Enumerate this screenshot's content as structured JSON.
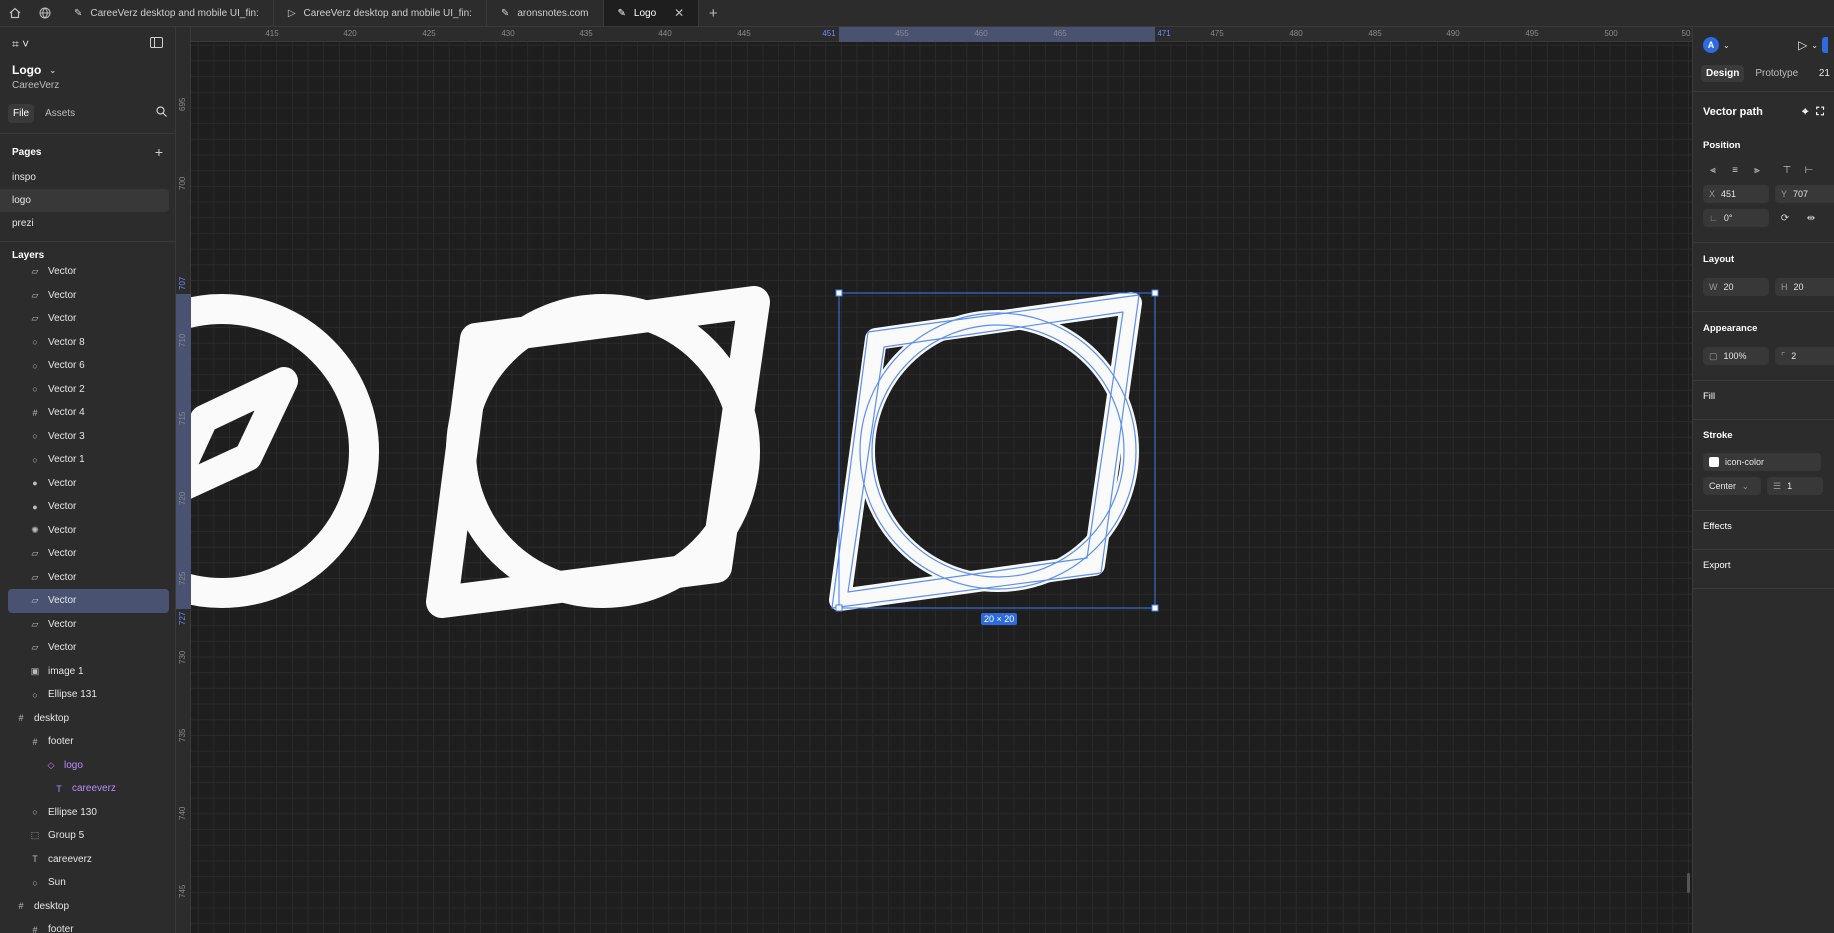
{
  "tabs": [
    {
      "label": "CareeVerz desktop and mobile UI_fin:",
      "active": false
    },
    {
      "label": "CareeVerz desktop and mobile UI_fin:",
      "active": false
    },
    {
      "label": "aronsnotes.com",
      "active": false
    },
    {
      "label": "Logo",
      "active": true
    }
  ],
  "file": {
    "title": "Logo",
    "subtitle": "CareeVerz"
  },
  "left": {
    "file_tab": "File",
    "assets_tab": "Assets",
    "pages_heading": "Pages",
    "pages": [
      "inspo",
      "logo",
      "prezi"
    ],
    "layers_heading": "Layers",
    "layers": [
      {
        "label": "Vector",
        "icon": "path"
      },
      {
        "label": "Vector",
        "icon": "path"
      },
      {
        "label": "Vector",
        "icon": "path"
      },
      {
        "label": "Vector 8",
        "icon": "ellipse"
      },
      {
        "label": "Vector 6",
        "icon": "ellipse"
      },
      {
        "label": "Vector 2",
        "icon": "ellipse"
      },
      {
        "label": "Vector 4",
        "icon": "frame"
      },
      {
        "label": "Vector 3",
        "icon": "ellipse"
      },
      {
        "label": "Vector 1",
        "icon": "ellipse"
      },
      {
        "label": "Vector",
        "icon": "filled"
      },
      {
        "label": "Vector",
        "icon": "filled"
      },
      {
        "label": "Vector",
        "icon": "sun"
      },
      {
        "label": "Vector",
        "icon": "path"
      },
      {
        "label": "Vector",
        "icon": "path"
      },
      {
        "label": "Vector",
        "icon": "path",
        "selected": true
      },
      {
        "label": "Vector",
        "icon": "path"
      },
      {
        "label": "Vector",
        "icon": "path"
      },
      {
        "label": "image 1",
        "icon": "image"
      },
      {
        "label": "Ellipse 131",
        "icon": "ellipse"
      },
      {
        "label": "desktop",
        "icon": "frame"
      },
      {
        "label": "footer",
        "icon": "frame"
      },
      {
        "label": "logo",
        "icon": "component"
      },
      {
        "label": "careeverz",
        "icon": "text"
      },
      {
        "label": "Ellipse 130",
        "icon": "ellipse"
      },
      {
        "label": "Group 5",
        "icon": "group"
      },
      {
        "label": "careeverz",
        "icon": "text"
      },
      {
        "label": "Sun",
        "icon": "ellipse"
      },
      {
        "label": "desktop",
        "icon": "frame"
      },
      {
        "label": "footer",
        "icon": "frame"
      }
    ]
  },
  "ruler": {
    "top": [
      "415",
      "420",
      "425",
      "430",
      "435",
      "440",
      "445",
      "451",
      "455",
      "460",
      "465",
      "471",
      "475",
      "480",
      "485",
      "490",
      "495",
      "500",
      "50"
    ],
    "left": [
      "695",
      "700",
      "707",
      "710",
      "715",
      "720",
      "725",
      "727",
      "730",
      "735",
      "740",
      "745"
    ]
  },
  "canvas": {
    "size_badge": "20 × 20"
  },
  "right": {
    "avatar": "A",
    "design_tab": "Design",
    "prototype_tab": "Prototype",
    "zoom": "21",
    "selection_type": "Vector path",
    "position_label": "Position",
    "x": "451",
    "y": "707",
    "rotation": "0°",
    "layout_label": "Layout",
    "w": "20",
    "h": "20",
    "appearance_label": "Appearance",
    "opacity": "100%",
    "radius": "2",
    "fill_label": "Fill",
    "stroke_label": "Stroke",
    "stroke_name": "icon-color",
    "stroke_align": "Center",
    "stroke_weight": "1",
    "effects_label": "Effects",
    "export_label": "Export"
  },
  "colors": {
    "accent": "#2d6be0",
    "selection": "#4a5271",
    "panel": "#2c2c2c",
    "canvas": "#1e1e1e"
  }
}
